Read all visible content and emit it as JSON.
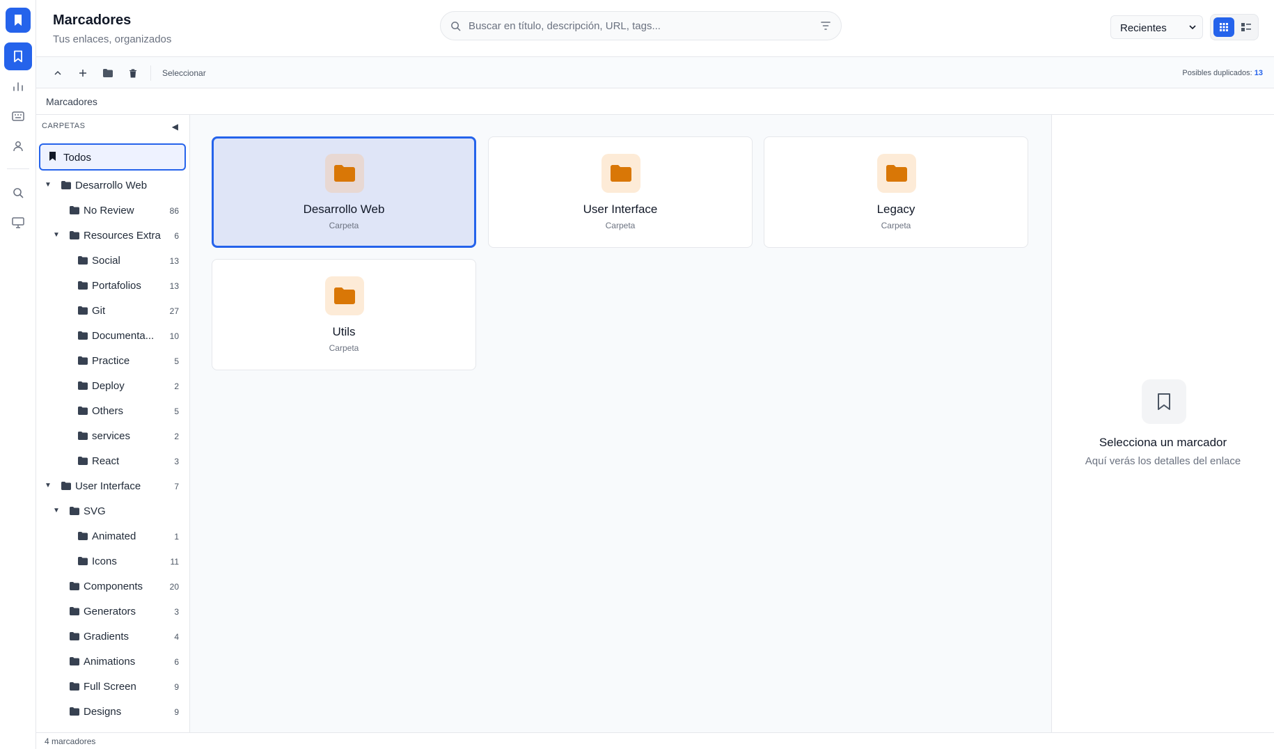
{
  "app": {
    "title": "Marcadores",
    "subtitle": "Tus enlaces, organizados"
  },
  "rail": {
    "icons": [
      "bookmark-logo-icon",
      "bookmark-icon",
      "bar-chart-icon",
      "keyboard-icon",
      "user-icon",
      "search-icon",
      "monitor-icon"
    ]
  },
  "search": {
    "placeholder": "Buscar en título, descripción, URL, tags..."
  },
  "sort": {
    "selected": "Recientes"
  },
  "toolbar": {
    "select_label": "Seleccionar",
    "duplicates_label": "Posibles duplicados:",
    "duplicates_count": "13"
  },
  "breadcrumb": "Marcadores",
  "tree": {
    "header": "CARPETAS",
    "todos": "Todos",
    "items": [
      {
        "label": "Desarrollo Web",
        "count": "",
        "level": 0,
        "expanded": true
      },
      {
        "label": "No Review",
        "count": "86",
        "level": 1,
        "expanded": null
      },
      {
        "label": "Resources Extra",
        "count": "6",
        "level": 1,
        "expanded": true
      },
      {
        "label": "Social",
        "count": "13",
        "level": 2,
        "expanded": null
      },
      {
        "label": "Portafolios",
        "count": "13",
        "level": 2,
        "expanded": null
      },
      {
        "label": "Git",
        "count": "27",
        "level": 2,
        "expanded": null
      },
      {
        "label": "Documenta...",
        "count": "10",
        "level": 2,
        "expanded": null
      },
      {
        "label": "Practice",
        "count": "5",
        "level": 2,
        "expanded": null
      },
      {
        "label": "Deploy",
        "count": "2",
        "level": 2,
        "expanded": null
      },
      {
        "label": "Others",
        "count": "5",
        "level": 2,
        "expanded": null
      },
      {
        "label": "services",
        "count": "2",
        "level": 2,
        "expanded": null
      },
      {
        "label": "React",
        "count": "3",
        "level": 2,
        "expanded": null
      },
      {
        "label": "User Interface",
        "count": "7",
        "level": 0,
        "expanded": true
      },
      {
        "label": "SVG",
        "count": "",
        "level": 1,
        "expanded": true
      },
      {
        "label": "Animated",
        "count": "1",
        "level": 2,
        "expanded": null
      },
      {
        "label": "Icons",
        "count": "11",
        "level": 2,
        "expanded": null
      },
      {
        "label": "Components",
        "count": "20",
        "level": 1,
        "expanded": null
      },
      {
        "label": "Generators",
        "count": "3",
        "level": 1,
        "expanded": null
      },
      {
        "label": "Gradients",
        "count": "4",
        "level": 1,
        "expanded": null
      },
      {
        "label": "Animations",
        "count": "6",
        "level": 1,
        "expanded": null
      },
      {
        "label": "Full Screen",
        "count": "9",
        "level": 1,
        "expanded": null
      },
      {
        "label": "Designs",
        "count": "9",
        "level": 1,
        "expanded": null
      }
    ]
  },
  "cards": [
    {
      "name": "Desarrollo Web",
      "type": "Carpeta",
      "selected": true
    },
    {
      "name": "User Interface",
      "type": "Carpeta",
      "selected": false
    },
    {
      "name": "Legacy",
      "type": "Carpeta",
      "selected": false
    },
    {
      "name": "Utils",
      "type": "Carpeta",
      "selected": false
    }
  ],
  "details": {
    "title": "Selecciona un marcador",
    "subtitle": "Aquí verás los detalles del enlace"
  },
  "footer": "4 marcadores",
  "colors": {
    "accent": "#2563eb",
    "folder": "#d97706",
    "folder_bg": "#fdebd7"
  }
}
